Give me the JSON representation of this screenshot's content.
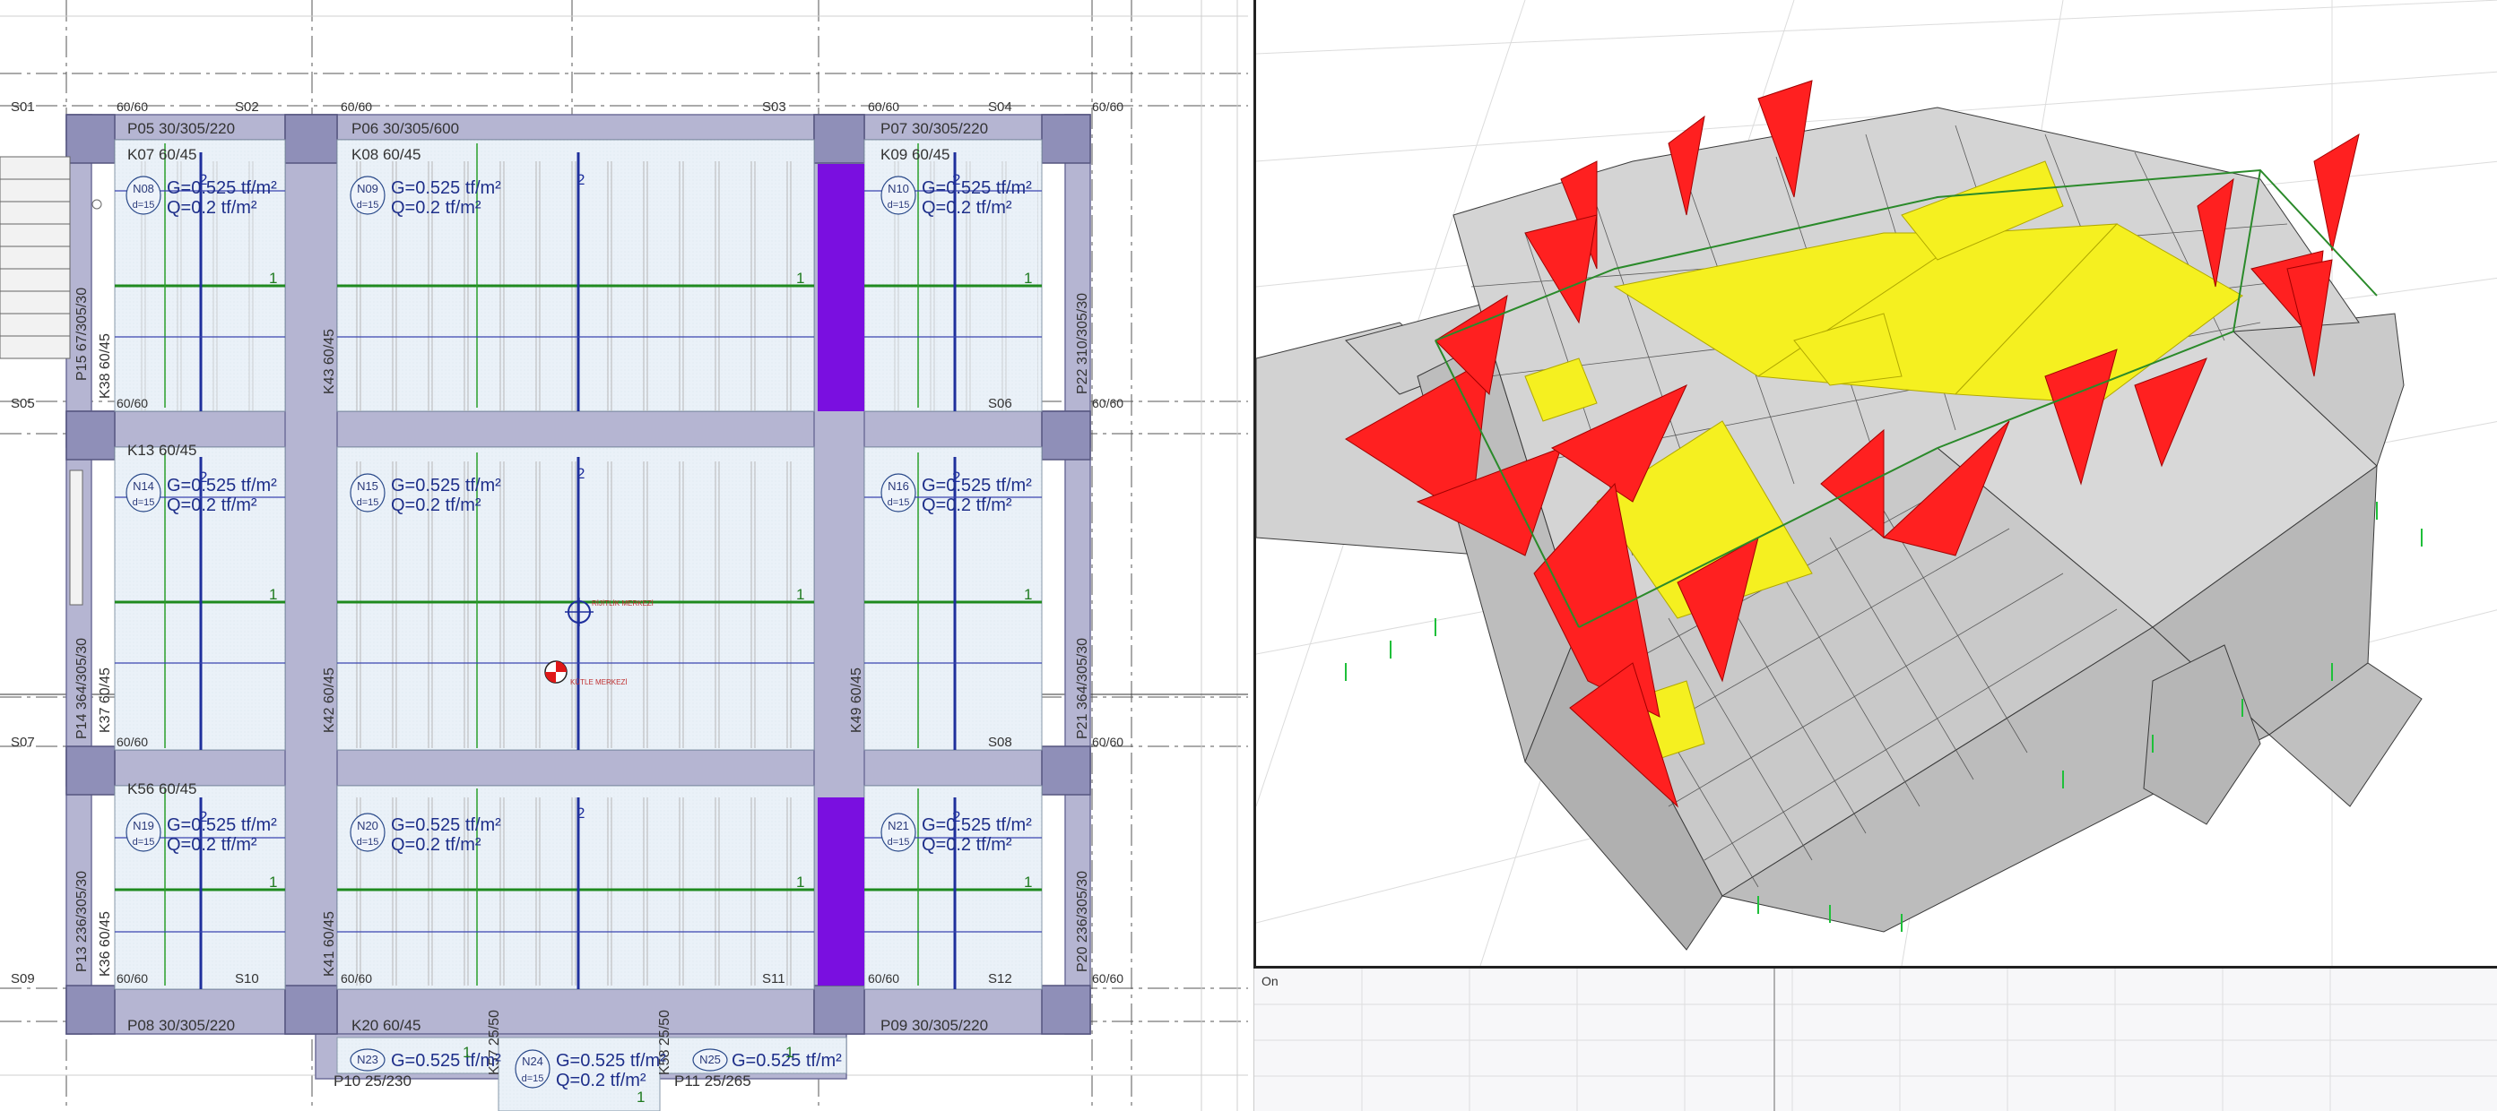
{
  "plan": {
    "axes": [
      "S01",
      "S02",
      "S03",
      "S04",
      "S05",
      "S06",
      "S07",
      "S08",
      "S09",
      "S10",
      "S11",
      "S12"
    ],
    "column_size": "60/60",
    "beams": {
      "P05": "P05 30/305/220",
      "P06": "P06 30/305/600",
      "P07": "P07 30/305/220",
      "P08": "P08 30/305/220",
      "P09": "P09 30/305/220",
      "P10": "P10 25/230",
      "P11": "P11 25/265",
      "P13": "P13 236/305/30",
      "P14": "P14 364/305/30",
      "P15": "P15 67/305/30",
      "P20": "P20 236/305/30",
      "P21": "P21 364/305/30",
      "P22": "P22 310/305/30",
      "K07": "K07 60/45",
      "K08": "K08 60/45",
      "K09": "K09 60/45",
      "K13": "K13 60/45",
      "K56": "K56 60/45",
      "K20": "K20 60/45",
      "K36": "K36 60/45",
      "K37": "K37 60/45",
      "K38": "K38 60/45",
      "K41": "K41 60/45",
      "K42": "K42 60/45",
      "K43": "K43 60/45",
      "K49": "K49 60/45",
      "K57": "K57 25/50",
      "K58": "K58 25/50"
    },
    "slabs": [
      {
        "id": "N08"
      },
      {
        "id": "N09"
      },
      {
        "id": "N10"
      },
      {
        "id": "N14"
      },
      {
        "id": "N15"
      },
      {
        "id": "N16"
      },
      {
        "id": "N19"
      },
      {
        "id": "N20"
      },
      {
        "id": "N21"
      },
      {
        "id": "N23"
      },
      {
        "id": "N24"
      },
      {
        "id": "N25"
      }
    ],
    "slab_thickness": "d=15",
    "load_g": "G=0.525 tf/m²",
    "load_q": "Q=0.2 tf/m²",
    "marker_1": "1",
    "marker_2": "2",
    "rigidity_center_label": "RİJİTLİK MERKEZİ",
    "mass_center_label": "KÜTLE MERKEZİ",
    "colors": {
      "slab": "#eaf1f8",
      "beam": "#a5a5c8",
      "support": "#7a0fe0",
      "green": "#1f8a1f",
      "blue": "#1e2f9c"
    }
  },
  "view3d": {
    "colors": {
      "mesh": "#c8c8c8",
      "moment_red": "#ff2020",
      "moment_yellow": "#f5f020",
      "support": "#1fbf3a"
    }
  },
  "bottom_pane": {
    "label": "On"
  }
}
